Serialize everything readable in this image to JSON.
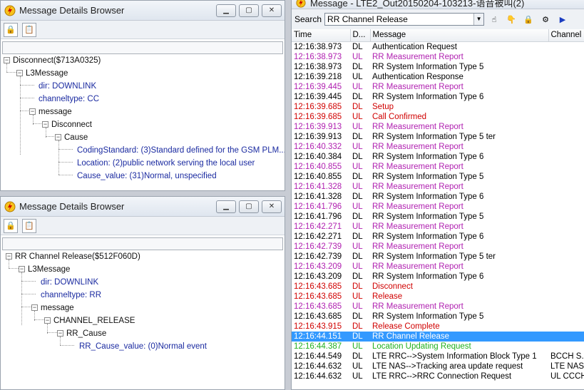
{
  "colors": {
    "dark": "#000000",
    "ul": "#b020b0",
    "dl_red": "#d00000",
    "green": "#20b020",
    "selected_bg": "#3399ff"
  },
  "top_browser": {
    "title": "Message Details Browser",
    "tree": [
      {
        "text": "Disconnect($713A0325)",
        "color": "dark"
      },
      {
        "text": "L3Message",
        "color": "dark"
      },
      {
        "text": "dir: DOWNLINK",
        "color": "blue"
      },
      {
        "text": "channeltype: CC",
        "color": "blue"
      },
      {
        "text": "message",
        "color": "dark"
      },
      {
        "text": "Disconnect",
        "color": "dark"
      },
      {
        "text": "Cause",
        "color": "dark"
      },
      {
        "text": "CodingStandard: (3)Standard defined for the GSM PLM...",
        "color": "blue"
      },
      {
        "text": "Location: (2)public network serving the local user",
        "color": "blue"
      },
      {
        "text": "Cause_value: (31)Normal, unspecified",
        "color": "blue"
      }
    ]
  },
  "bottom_browser": {
    "title": "Message Details Browser",
    "tree": [
      {
        "text": "RR Channel Release($512F060D)",
        "color": "dark"
      },
      {
        "text": "L3Message",
        "color": "dark"
      },
      {
        "text": "dir: DOWNLINK",
        "color": "blue"
      },
      {
        "text": "channeltype: RR",
        "color": "blue"
      },
      {
        "text": "message",
        "color": "dark"
      },
      {
        "text": "CHANNEL_RELEASE",
        "color": "dark"
      },
      {
        "text": "RR_Cause",
        "color": "dark"
      },
      {
        "text": "RR_Cause_value: (0)Normal event",
        "color": "blue"
      }
    ]
  },
  "message_window": {
    "title": "Message - LTE2_Out20150204-103213-语音被叫(2)",
    "search_label": "Search",
    "search_value": "RR Channel Release",
    "columns": [
      "Time",
      "D...",
      "Message",
      "Channel"
    ],
    "rows": [
      {
        "time": "12:16:38.973",
        "dir": "DL",
        "msg": "Authentication Request",
        "ch": "",
        "color": "dark"
      },
      {
        "time": "12:16:38.973",
        "dir": "UL",
        "msg": "RR Measurement Report",
        "ch": "",
        "color": "ul"
      },
      {
        "time": "12:16:38.973",
        "dir": "DL",
        "msg": "RR System Information Type 5",
        "ch": "",
        "color": "dark"
      },
      {
        "time": "12:16:39.218",
        "dir": "UL",
        "msg": "Authentication Response",
        "ch": "",
        "color": "dark"
      },
      {
        "time": "12:16:39.445",
        "dir": "UL",
        "msg": "RR Measurement Report",
        "ch": "",
        "color": "ul"
      },
      {
        "time": "12:16:39.445",
        "dir": "DL",
        "msg": "RR System Information Type 6",
        "ch": "",
        "color": "dark"
      },
      {
        "time": "12:16:39.685",
        "dir": "DL",
        "msg": "Setup",
        "ch": "",
        "color": "dl_red"
      },
      {
        "time": "12:16:39.685",
        "dir": "UL",
        "msg": "Call Confirmed",
        "ch": "",
        "color": "dl_red"
      },
      {
        "time": "12:16:39.913",
        "dir": "UL",
        "msg": "RR Measurement Report",
        "ch": "",
        "color": "ul"
      },
      {
        "time": "12:16:39.913",
        "dir": "DL",
        "msg": "RR System Information Type 5 ter",
        "ch": "",
        "color": "dark"
      },
      {
        "time": "12:16:40.332",
        "dir": "UL",
        "msg": "RR Measurement Report",
        "ch": "",
        "color": "ul"
      },
      {
        "time": "12:16:40.384",
        "dir": "DL",
        "msg": "RR System Information Type 6",
        "ch": "",
        "color": "dark"
      },
      {
        "time": "12:16:40.855",
        "dir": "UL",
        "msg": "RR Measurement Report",
        "ch": "",
        "color": "ul"
      },
      {
        "time": "12:16:40.855",
        "dir": "DL",
        "msg": "RR System Information Type 5",
        "ch": "",
        "color": "dark"
      },
      {
        "time": "12:16:41.328",
        "dir": "UL",
        "msg": "RR Measurement Report",
        "ch": "",
        "color": "ul"
      },
      {
        "time": "12:16:41.328",
        "dir": "DL",
        "msg": "RR System Information Type 6",
        "ch": "",
        "color": "dark"
      },
      {
        "time": "12:16:41.796",
        "dir": "UL",
        "msg": "RR Measurement Report",
        "ch": "",
        "color": "ul"
      },
      {
        "time": "12:16:41.796",
        "dir": "DL",
        "msg": "RR System Information Type 5",
        "ch": "",
        "color": "dark"
      },
      {
        "time": "12:16:42.271",
        "dir": "UL",
        "msg": "RR Measurement Report",
        "ch": "",
        "color": "ul"
      },
      {
        "time": "12:16:42.271",
        "dir": "DL",
        "msg": "RR System Information Type 6",
        "ch": "",
        "color": "dark"
      },
      {
        "time": "12:16:42.739",
        "dir": "UL",
        "msg": "RR Measurement Report",
        "ch": "",
        "color": "ul"
      },
      {
        "time": "12:16:42.739",
        "dir": "DL",
        "msg": "RR System Information Type 5 ter",
        "ch": "",
        "color": "dark"
      },
      {
        "time": "12:16:43.209",
        "dir": "UL",
        "msg": "RR Measurement Report",
        "ch": "",
        "color": "ul"
      },
      {
        "time": "12:16:43.209",
        "dir": "DL",
        "msg": "RR System Information Type 6",
        "ch": "",
        "color": "dark"
      },
      {
        "time": "12:16:43.685",
        "dir": "DL",
        "msg": "Disconnect",
        "ch": "",
        "color": "dl_red"
      },
      {
        "time": "12:16:43.685",
        "dir": "UL",
        "msg": "Release",
        "ch": "",
        "color": "dl_red"
      },
      {
        "time": "12:16:43.685",
        "dir": "UL",
        "msg": "RR Measurement Report",
        "ch": "",
        "color": "ul"
      },
      {
        "time": "12:16:43.685",
        "dir": "DL",
        "msg": "RR System Information Type 5",
        "ch": "",
        "color": "dark"
      },
      {
        "time": "12:16:43.915",
        "dir": "DL",
        "msg": "Release Complete",
        "ch": "",
        "color": "dl_red"
      },
      {
        "time": "12:16:44.151",
        "dir": "DL",
        "msg": "RR Channel Release",
        "ch": "",
        "color": "dark",
        "selected": true
      },
      {
        "time": "12:16:44.387",
        "dir": "UL",
        "msg": "Location Updating Request",
        "ch": "",
        "color": "green"
      },
      {
        "time": "12:16:44.549",
        "dir": "DL",
        "msg": "LTE RRC-->System Information Block Type 1",
        "ch": "BCCH S...",
        "color": "dark"
      },
      {
        "time": "12:16:44.632",
        "dir": "UL",
        "msg": "LTE NAS-->Tracking area update request",
        "ch": "LTE NAS",
        "color": "dark"
      },
      {
        "time": "12:16:44.632",
        "dir": "UL",
        "msg": "LTE RRC-->RRC Connection Request",
        "ch": "UL CCCH",
        "color": "dark"
      }
    ]
  }
}
